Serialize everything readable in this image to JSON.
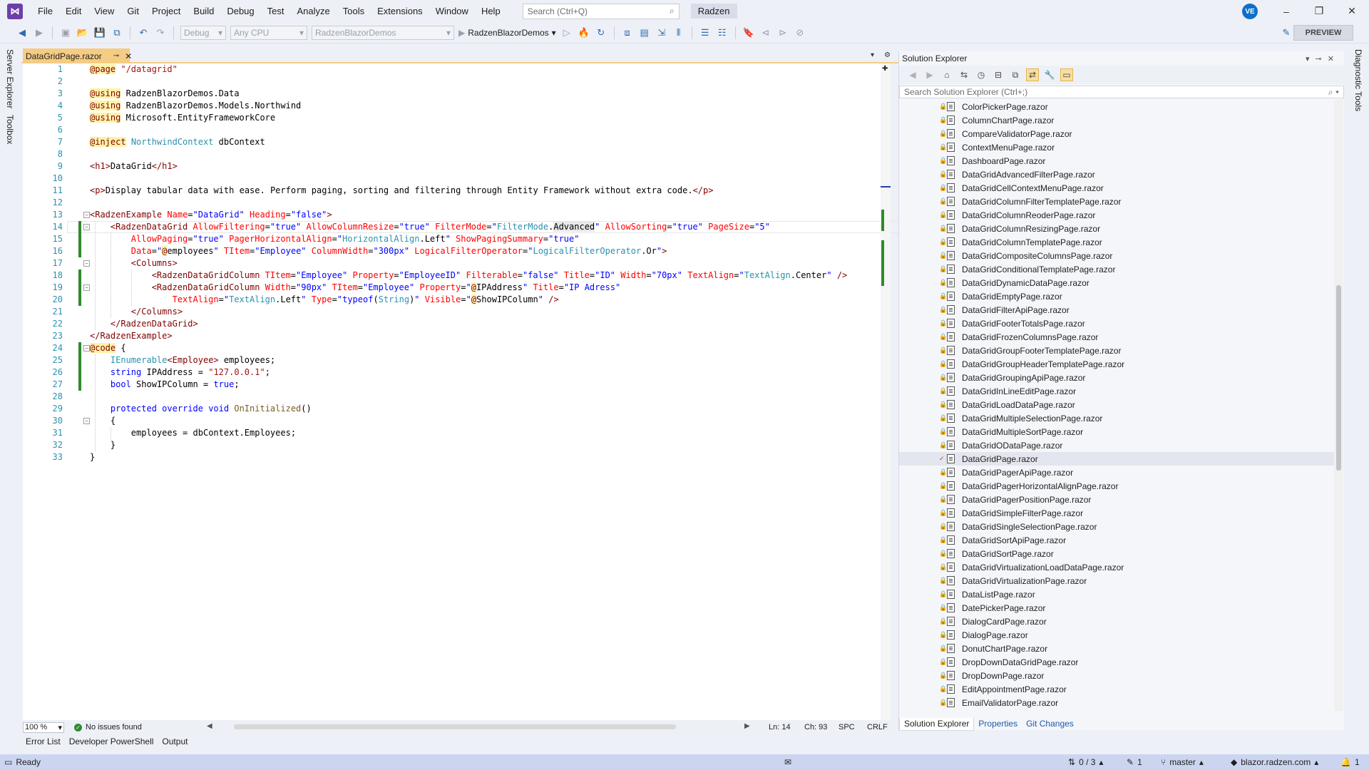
{
  "menubar": {
    "items": [
      "File",
      "Edit",
      "View",
      "Git",
      "Project",
      "Build",
      "Debug",
      "Test",
      "Analyze",
      "Tools",
      "Extensions",
      "Window",
      "Help"
    ],
    "search_placeholder": "Search (Ctrl+Q)",
    "solution_name": "Radzen",
    "user_initials": "VE"
  },
  "toolbar": {
    "config": "Debug",
    "platform": "Any CPU",
    "project": "RadzenBlazorDemos",
    "run_target": "RadzenBlazorDemos",
    "preview_label": "PREVIEW"
  },
  "left_rail": [
    "Server Explorer",
    "Toolbox"
  ],
  "right_rail": [
    "Diagnostic Tools"
  ],
  "editor": {
    "tab_title": "DataGridPage.razor",
    "current_line": 14,
    "lines": [
      {
        "n": 1,
        "text": "@page \"/datagrid\""
      },
      {
        "n": 2,
        "text": ""
      },
      {
        "n": 3,
        "text": "@using RadzenBlazorDemos.Data"
      },
      {
        "n": 4,
        "text": "@using RadzenBlazorDemos.Models.Northwind"
      },
      {
        "n": 5,
        "text": "@using Microsoft.EntityFrameworkCore"
      },
      {
        "n": 6,
        "text": ""
      },
      {
        "n": 7,
        "text": "@inject NorthwindContext dbContext"
      },
      {
        "n": 8,
        "text": ""
      },
      {
        "n": 9,
        "text": "<h1>DataGrid</h1>"
      },
      {
        "n": 10,
        "text": ""
      },
      {
        "n": 11,
        "text": "<p>Display tabular data with ease. Perform paging, sorting and filtering through Entity Framework without extra code.</p>"
      },
      {
        "n": 12,
        "text": ""
      },
      {
        "n": 13,
        "text": "<RadzenExample Name=\"DataGrid\" Heading=\"false\">"
      },
      {
        "n": 14,
        "text": "    <RadzenDataGrid AllowFiltering=\"true\" AllowColumnResize=\"true\" FilterMode=\"FilterMode.Advanced\" AllowSorting=\"true\" PageSize=\"5\""
      },
      {
        "n": 15,
        "text": "        AllowPaging=\"true\" PagerHorizontalAlign=\"HorizontalAlign.Left\" ShowPagingSummary=\"true\""
      },
      {
        "n": 16,
        "text": "        Data=\"@employees\" TItem=\"Employee\" ColumnWidth=\"300px\" LogicalFilterOperator=\"LogicalFilterOperator.Or\">"
      },
      {
        "n": 17,
        "text": "        <Columns>"
      },
      {
        "n": 18,
        "text": "            <RadzenDataGridColumn TItem=\"Employee\" Property=\"EmployeeID\" Filterable=\"false\" Title=\"ID\" Width=\"70px\" TextAlign=\"TextAlign.Center\" />"
      },
      {
        "n": 19,
        "text": "            <RadzenDataGridColumn Width=\"90px\" TItem=\"Employee\" Property=\"@IPAddress\" Title=\"IP Adress\""
      },
      {
        "n": 20,
        "text": "                TextAlign=\"TextAlign.Left\" Type=\"typeof(String)\" Visible=\"@ShowIPColumn\" />"
      },
      {
        "n": 21,
        "text": "        </Columns>"
      },
      {
        "n": 22,
        "text": "    </RadzenDataGrid>"
      },
      {
        "n": 23,
        "text": "</RadzenExample>"
      },
      {
        "n": 24,
        "text": "@code {"
      },
      {
        "n": 25,
        "text": "    IEnumerable<Employee> employees;"
      },
      {
        "n": 26,
        "text": "    string IPAddress = \"127.0.0.1\";"
      },
      {
        "n": 27,
        "text": "    bool ShowIPColumn = true;"
      },
      {
        "n": 28,
        "text": ""
      },
      {
        "n": 29,
        "text": "    protected override void OnInitialized()"
      },
      {
        "n": 30,
        "text": "    {"
      },
      {
        "n": 31,
        "text": "        employees = dbContext.Employees;"
      },
      {
        "n": 32,
        "text": "    }"
      },
      {
        "n": 33,
        "text": "}"
      }
    ],
    "status": {
      "zoom": "100 %",
      "issues": "No issues found",
      "ln": "Ln: 14",
      "ch": "Ch: 93",
      "spc": "SPC",
      "eol": "CRLF"
    }
  },
  "solution_explorer": {
    "title": "Solution Explorer",
    "search_placeholder": "Search Solution Explorer (Ctrl+;)",
    "selected": "DataGridPage.razor",
    "files": [
      "ColorPickerPage.razor",
      "ColumnChartPage.razor",
      "CompareValidatorPage.razor",
      "ContextMenuPage.razor",
      "DashboardPage.razor",
      "DataGridAdvancedFilterPage.razor",
      "DataGridCellContextMenuPage.razor",
      "DataGridColumnFilterTemplatePage.razor",
      "DataGridColumnReoderPage.razor",
      "DataGridColumnResizingPage.razor",
      "DataGridColumnTemplatePage.razor",
      "DataGridCompositeColumnsPage.razor",
      "DataGridConditionalTemplatePage.razor",
      "DataGridDynamicDataPage.razor",
      "DataGridEmptyPage.razor",
      "DataGridFilterApiPage.razor",
      "DataGridFooterTotalsPage.razor",
      "DataGridFrozenColumnsPage.razor",
      "DataGridGroupFooterTemplatePage.razor",
      "DataGridGroupHeaderTemplatePage.razor",
      "DataGridGroupingApiPage.razor",
      "DataGridInLineEditPage.razor",
      "DataGridLoadDataPage.razor",
      "DataGridMultipleSelectionPage.razor",
      "DataGridMultipleSortPage.razor",
      "DataGridODataPage.razor",
      "DataGridPage.razor",
      "DataGridPagerApiPage.razor",
      "DataGridPagerHorizontalAlignPage.razor",
      "DataGridPagerPositionPage.razor",
      "DataGridSimpleFilterPage.razor",
      "DataGridSingleSelectionPage.razor",
      "DataGridSortApiPage.razor",
      "DataGridSortPage.razor",
      "DataGridVirtualizationLoadDataPage.razor",
      "DataGridVirtualizationPage.razor",
      "DataListPage.razor",
      "DatePickerPage.razor",
      "DialogCardPage.razor",
      "DialogPage.razor",
      "DonutChartPage.razor",
      "DropDownDataGridPage.razor",
      "DropDownPage.razor",
      "EditAppointmentPage.razor",
      "EmailValidatorPage.razor"
    ],
    "bottom_tabs": [
      "Solution Explorer",
      "Properties",
      "Git Changes"
    ]
  },
  "bottom_tool_tabs": [
    "Error List",
    "Developer PowerShell",
    "Output"
  ],
  "statusbar": {
    "ready": "Ready",
    "sync": "0 / 3",
    "edits": "1",
    "branch": "master",
    "repo": "blazor.radzen.com",
    "notifications": "1"
  },
  "colors": {
    "accent": "#F5CC84",
    "statusbar": "#CCD5F0",
    "change_marker": "#2E8B2E"
  }
}
